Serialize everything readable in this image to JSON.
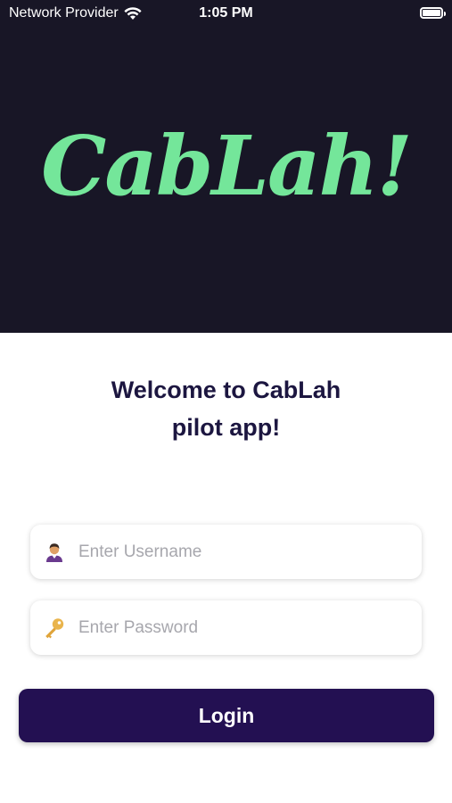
{
  "status_bar": {
    "carrier": "Network Provider",
    "time": "1:05 PM",
    "wifi_icon": "wifi-icon",
    "battery_icon": "battery-icon",
    "battery_level": 1.0
  },
  "hero": {
    "logo_text": "CabLah!",
    "background_color": "#181626",
    "logo_color": "#74e69a"
  },
  "welcome": {
    "line1": "Welcome to CabLah",
    "line2": "pilot app!"
  },
  "form": {
    "username": {
      "icon": "user-icon",
      "placeholder": "Enter Username",
      "value": ""
    },
    "password": {
      "icon": "key-icon",
      "placeholder": "Enter Password",
      "value": ""
    },
    "login_label": "Login",
    "login_color": "#231052"
  }
}
